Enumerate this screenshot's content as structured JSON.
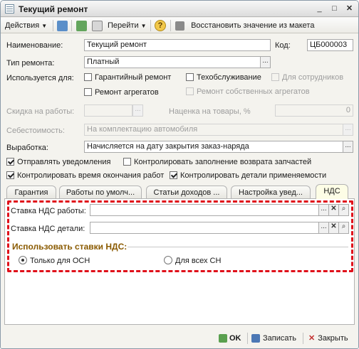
{
  "window": {
    "title": "Текущий ремонт"
  },
  "toolbar": {
    "actions_label": "Действия",
    "goto_label": "Перейти",
    "help_label": "?",
    "restore_label": "Восстановить значение из макета"
  },
  "form": {
    "name_label": "Наименование:",
    "name_value": "Текущий ремонт",
    "code_label": "Код:",
    "code_value": "ЦБ000003",
    "repair_type_label": "Тип ремонта:",
    "repair_type_value": "Платный",
    "used_for_label": "Используется для:",
    "used_for": [
      {
        "label": "Гарантийный ремонт",
        "checked": false,
        "disabled": false
      },
      {
        "label": "Техобслуживание",
        "checked": false,
        "disabled": false
      },
      {
        "label": "Для сотрудников",
        "checked": false,
        "disabled": true
      },
      {
        "label": "Ремонт агрегатов",
        "checked": false,
        "disabled": false
      },
      {
        "label": "Ремонт собственных агрегатов",
        "checked": false,
        "disabled": true
      }
    ],
    "discount_label": "Скидка на работы:",
    "markup_label": "Наценка на товары, %",
    "markup_value": "0",
    "cost_label": "Себестоимость:",
    "cost_value": "На комплектацию автомобиля",
    "output_label": "Выработка:",
    "output_value": "Начисляется на дату закрытия заказ-наряда",
    "options": [
      {
        "label": "Отправлять уведомления",
        "checked": true
      },
      {
        "label": "Контролировать заполнение возврата запчастей",
        "checked": false
      },
      {
        "label": "Контролировать время окончания работ",
        "checked": true
      },
      {
        "label": "Контролировать детали применяемости",
        "checked": true
      }
    ]
  },
  "tabs": [
    {
      "label": "Гарантия"
    },
    {
      "label": "Работы по умолч..."
    },
    {
      "label": "Статьи доходов ..."
    },
    {
      "label": "Настройка увед..."
    },
    {
      "label": "НДС"
    }
  ],
  "vat": {
    "work_rate_label": "Ставка НДС работы:",
    "work_rate_value": "",
    "parts_rate_label": "Ставка НДС детали:",
    "parts_rate_value": "",
    "use_rates_title": "Использовать ставки НДС:",
    "radio_osn": "Только для ОСН",
    "radio_all": "Для всех СН",
    "selected": "osn"
  },
  "buttons": {
    "ok": "OK",
    "save": "Записать",
    "close": "Закрыть"
  },
  "colors": {
    "highlight": "#e0101a",
    "group_title": "#8a5a00",
    "active_tab": "#fdfde6"
  },
  "icons": [
    "table-icon",
    "minimize-icon",
    "maximize-icon",
    "close-icon",
    "dropdown-arrow-icon",
    "clear-icon",
    "search-icon",
    "ok-check-icon",
    "save-icon",
    "close-form-icon"
  ]
}
